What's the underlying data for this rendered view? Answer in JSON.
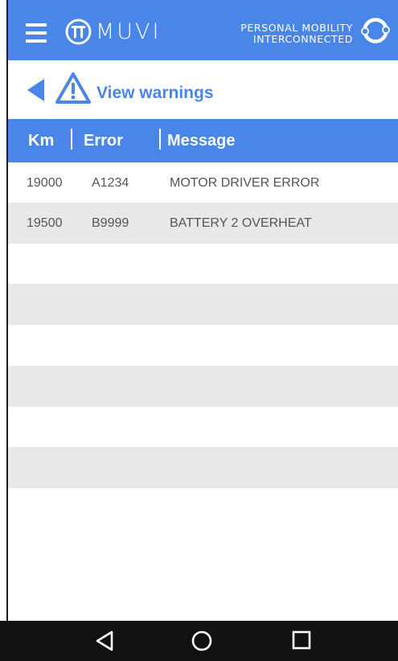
{
  "header": {
    "brand": "MUVI",
    "tagline_line1": "PERSONAL MOBILITY",
    "tagline_line2": "INTERCONNECTED",
    "accent_color": "#4a86e8"
  },
  "page": {
    "title": "View warnings"
  },
  "table": {
    "columns": [
      "Km",
      "Error",
      "Message"
    ],
    "rows": [
      {
        "km": "19000",
        "error": "A1234",
        "message": "MOTOR DRIVER ERROR"
      },
      {
        "km": "19500",
        "error": "B9999",
        "message": "BATTERY 2 OVERHEAT"
      },
      {
        "km": "",
        "error": "",
        "message": ""
      },
      {
        "km": "",
        "error": "",
        "message": ""
      },
      {
        "km": "",
        "error": "",
        "message": ""
      },
      {
        "km": "",
        "error": "",
        "message": ""
      },
      {
        "km": "",
        "error": "",
        "message": ""
      },
      {
        "km": "",
        "error": "",
        "message": ""
      }
    ]
  },
  "icons": {
    "menu": "hamburger-menu-icon",
    "logo": "muvi-logo-icon",
    "connect": "ring-connect-icon",
    "back": "back-arrow-icon",
    "warning": "warning-triangle-icon",
    "nav_back": "nav-back-icon",
    "nav_home": "nav-home-icon",
    "nav_recent": "nav-recent-apps-icon"
  }
}
